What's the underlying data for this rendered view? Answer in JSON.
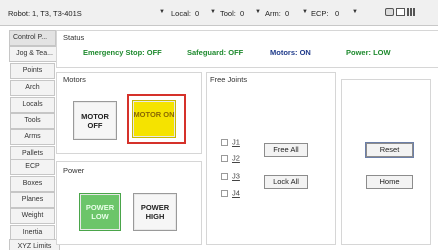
{
  "toolbar": {
    "robot_label": "Robot:",
    "robot_value": "1, T3, T3-401S",
    "local_label": "Local:",
    "local_value": "0",
    "tool_label": "Tool:",
    "tool_value": "0",
    "arm_label": "Arm:",
    "arm_value": "0",
    "ecp_label": "ECP:",
    "ecp_value": "0",
    "icons": [
      "speed-icon",
      "window-icon",
      "bars-icon"
    ]
  },
  "tabs": [
    "Control P...",
    "Jog & Tea...",
    "Points",
    "Arch",
    "Locals",
    "Tools",
    "Arms",
    "Pallets",
    "ECP",
    "Boxes",
    "Planes",
    "Weight",
    "Inertia",
    "XYZ Limits"
  ],
  "status": {
    "title": "Status",
    "emergency_stop": "Emergency Stop: OFF",
    "safeguard": "Safeguard: OFF",
    "motors": "Motors: ON",
    "power": "Power: LOW"
  },
  "motors": {
    "title": "Motors",
    "off_label": "MOTOR OFF",
    "on_label": "MOTOR ON"
  },
  "power": {
    "title": "Power",
    "low_label": "POWER LOW",
    "high_label": "POWER HIGH"
  },
  "free_joints": {
    "title": "Free Joints",
    "joints": [
      "J1",
      "J2",
      "J3",
      "J4"
    ],
    "free_all": "Free All",
    "lock_all": "Lock All"
  },
  "actions": {
    "reset": "Reset",
    "home": "Home"
  },
  "colors": {
    "status_green": "#1e8a2e",
    "status_blue": "#1e3a8a",
    "motor_on": "#f5e300",
    "power_low": "#6cc56a",
    "highlight": "#d5312a"
  }
}
